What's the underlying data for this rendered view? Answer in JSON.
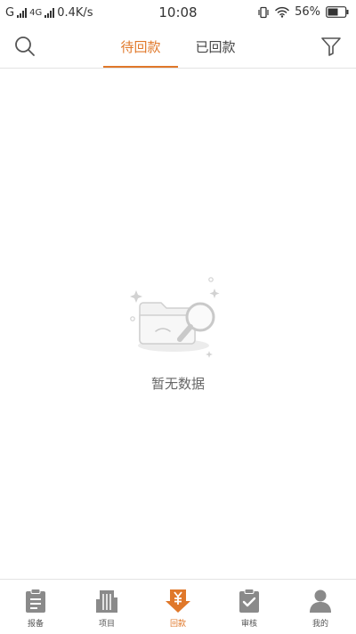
{
  "status_bar": {
    "carrier1": "G",
    "carrier2": "4G",
    "speed": "0.4K/s",
    "time": "10:08",
    "battery": "56%"
  },
  "header": {
    "tabs": [
      {
        "label": "待回款",
        "active": true
      },
      {
        "label": "已回款",
        "active": false
      }
    ]
  },
  "empty_state": {
    "message": "暂无数据"
  },
  "bottom_nav": {
    "items": [
      {
        "label": "报备",
        "icon": "clipboard-icon"
      },
      {
        "label": "项目",
        "icon": "building-icon"
      },
      {
        "label": "回款",
        "icon": "yuan-download-icon",
        "active": true
      },
      {
        "label": "审核",
        "icon": "check-clipboard-icon"
      },
      {
        "label": "我的",
        "icon": "user-icon"
      }
    ]
  },
  "colors": {
    "accent": "#e0782a",
    "icon_gray": "#8a8a8a",
    "divider": "#e3e3e3"
  }
}
